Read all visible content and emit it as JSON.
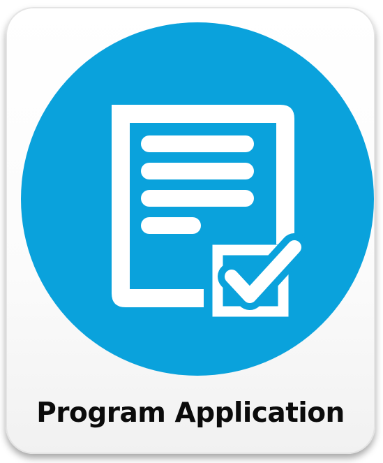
{
  "tile": {
    "label": "Program Application",
    "icon": "document-checkbox-icon"
  },
  "colors": {
    "circle": "#0aa2dc",
    "glyph": "#ffffff",
    "text": "#0b0b0b"
  }
}
